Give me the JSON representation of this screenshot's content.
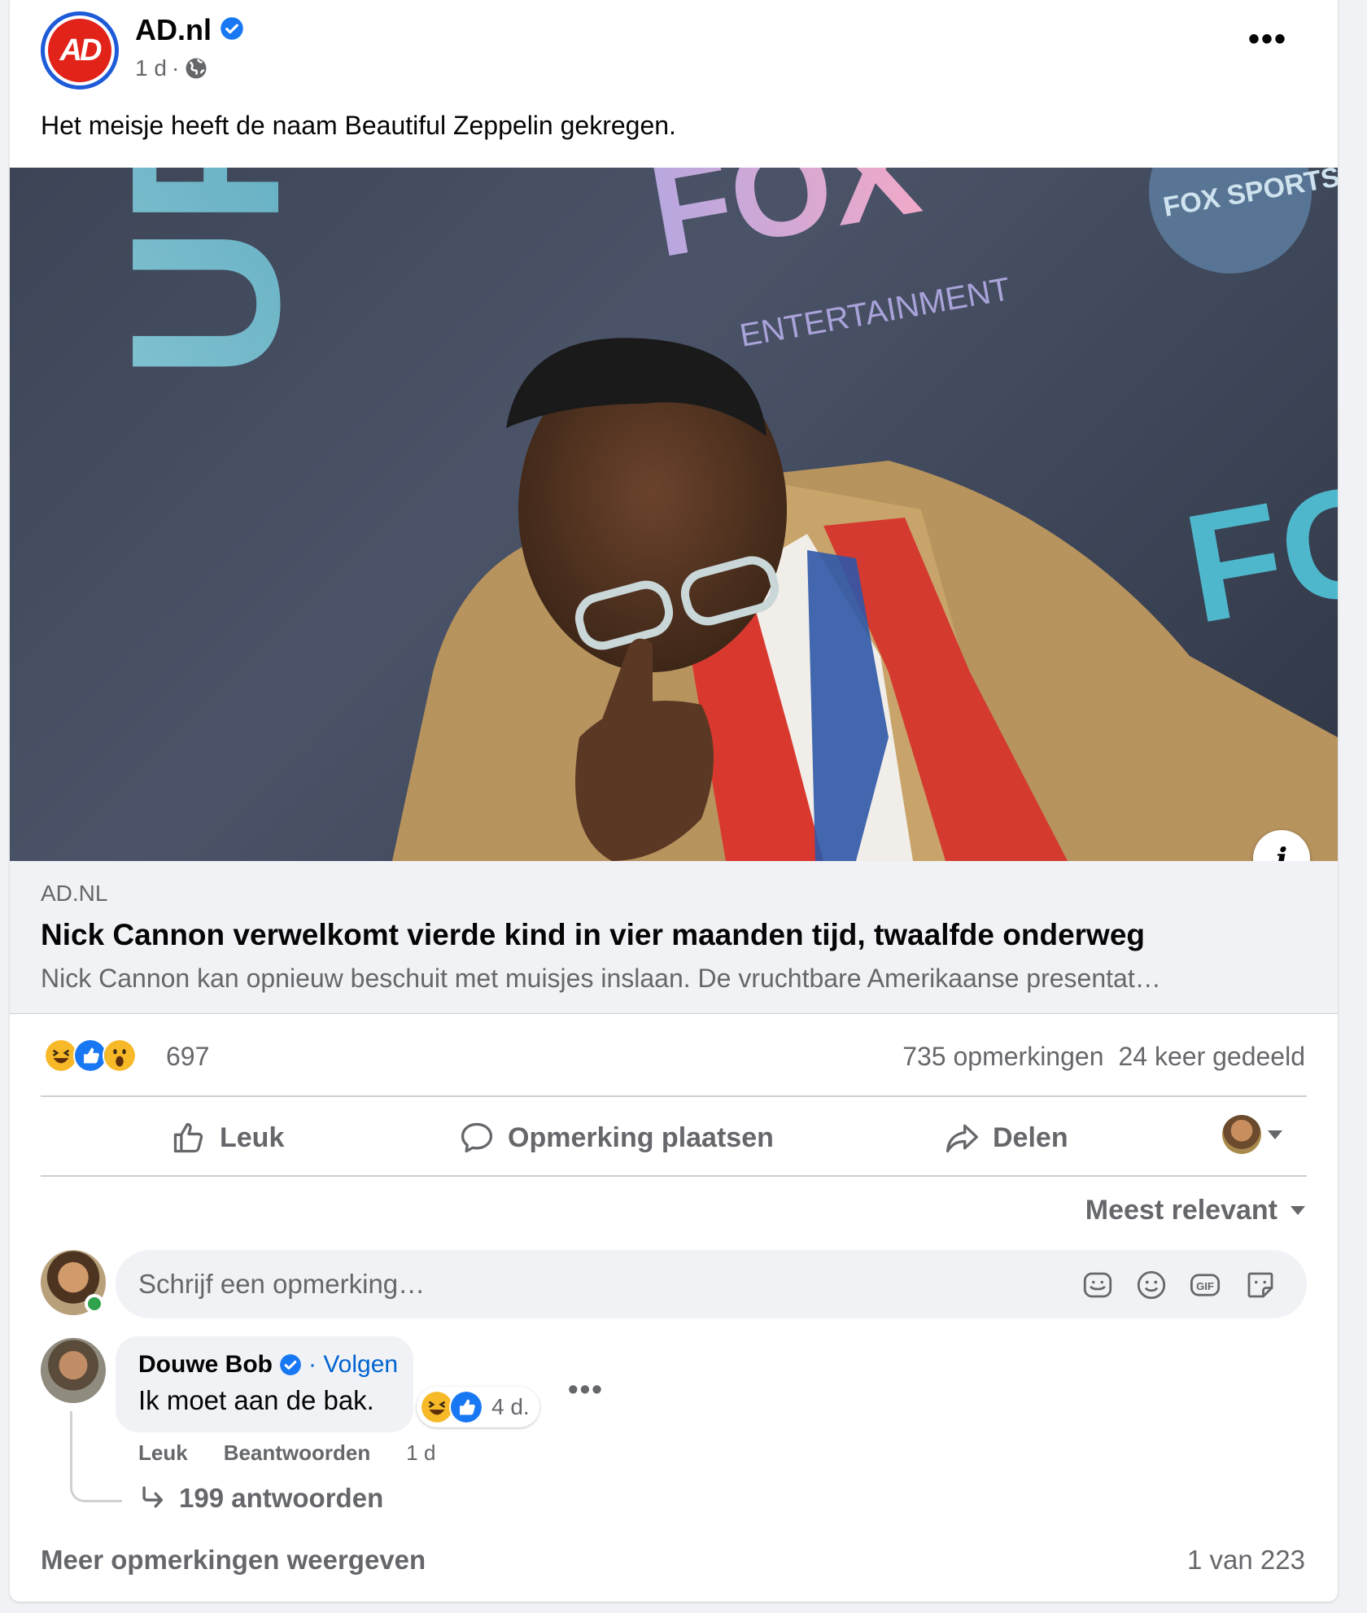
{
  "post": {
    "page_name": "AD.nl",
    "logo_text": "AD",
    "time": "1 d",
    "separator": "·",
    "caption": "Het meisje heeft de naam Beautiful Zeppelin gekregen."
  },
  "link_preview": {
    "domain": "AD.NL",
    "title": "Nick Cannon verwelkomt vierde kind in vier maanden tijd, twaalfde onderweg",
    "description": "Nick Cannon kan opnieuw beschuit met muisjes inslaan. De vruchtbare Amerikaanse presentat…",
    "photo_backdrop_texts": [
      "FOX",
      "ENTERTAINMENT",
      "FOX SPORTS",
      "UPF",
      "FO"
    ]
  },
  "reactions": {
    "count": "697",
    "types": [
      "haha",
      "like",
      "wow"
    ]
  },
  "stats": {
    "comments": "735 opmerkingen",
    "shares": "24 keer gedeeld"
  },
  "actions": {
    "like": "Leuk",
    "comment": "Opmerking plaatsen",
    "share": "Delen"
  },
  "sort": {
    "label": "Meest relevant"
  },
  "composer": {
    "placeholder": "Schrijf een opmerking…",
    "icons": [
      "avatar-sticker-icon",
      "emoji-icon",
      "gif-icon",
      "sticker-icon"
    ]
  },
  "comment": {
    "author": "Douwe Bob",
    "follow": "· Volgen",
    "text": "Ik moet aan de bak.",
    "reaction_time": "4 d.",
    "like": "Leuk",
    "reply": "Beantwoorden",
    "time": "1 d",
    "replies": "199 antwoorden"
  },
  "footer": {
    "more_comments": "Meer opmerkingen weergeven",
    "pager": "1 van 223"
  },
  "colors": {
    "accent_blue": "#0064d1",
    "secondary_text": "#65676b",
    "brand_red": "#e2231a",
    "verified_blue": "#1877f2"
  }
}
